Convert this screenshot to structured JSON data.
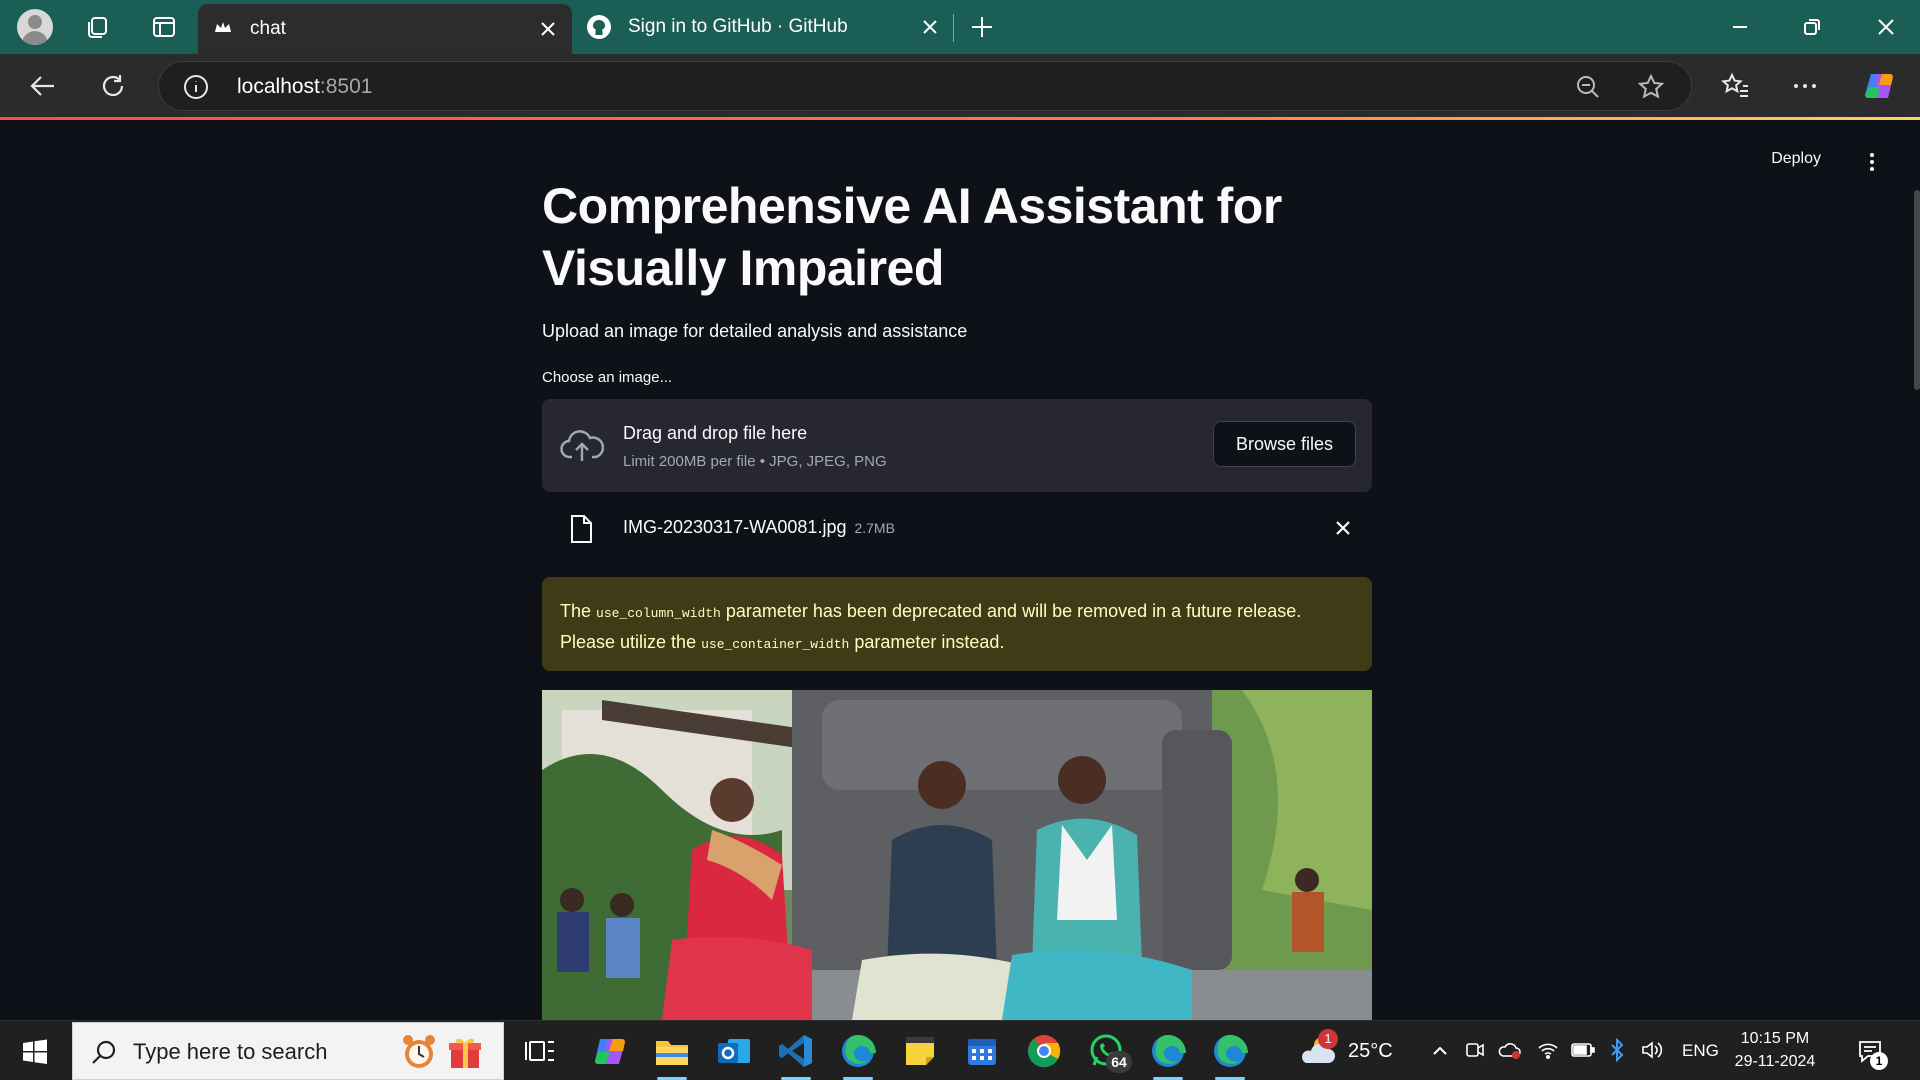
{
  "browser": {
    "tabs": [
      {
        "title": "chat",
        "active": true
      },
      {
        "title": "Sign in to GitHub · GitHub",
        "active": false
      }
    ],
    "address": {
      "host": "localhost",
      "port": ":8501"
    }
  },
  "app": {
    "header": {
      "deploy_label": "Deploy"
    },
    "title": "Comprehensive AI Assistant for Visually Impaired",
    "subtitle": "Upload an image for detailed analysis and assistance",
    "uploader": {
      "label": "Choose an image...",
      "drop_title": "Drag and drop file here",
      "limit_text": "Limit 200MB per file • JPG, JPEG, PNG",
      "browse_label": "Browse files"
    },
    "uploaded_file": {
      "name": "IMG-20230317-WA0081.jpg",
      "size": "2.7MB"
    },
    "warning": {
      "part1": "The ",
      "code1": "use_column_width",
      "part2": " parameter has been deprecated and will be removed in a future release. Please utilize the ",
      "code2": "use_container_width",
      "part3": " parameter instead."
    }
  },
  "taskbar": {
    "search_placeholder": "Type here to search",
    "whatsapp_badge": "64",
    "weather_badge": "1",
    "temperature": "25°C",
    "language": "ENG",
    "time": "10:15 PM",
    "date": "29-11-2024",
    "notification_count": "1"
  },
  "colors": {
    "tab_strip": "#1b5e56",
    "app_bg": "#0e1117",
    "uploader_bg": "#262730",
    "warning_bg": "#3e3b16",
    "warning_text": "#ffffc2",
    "accent": "#ff4b4b"
  }
}
